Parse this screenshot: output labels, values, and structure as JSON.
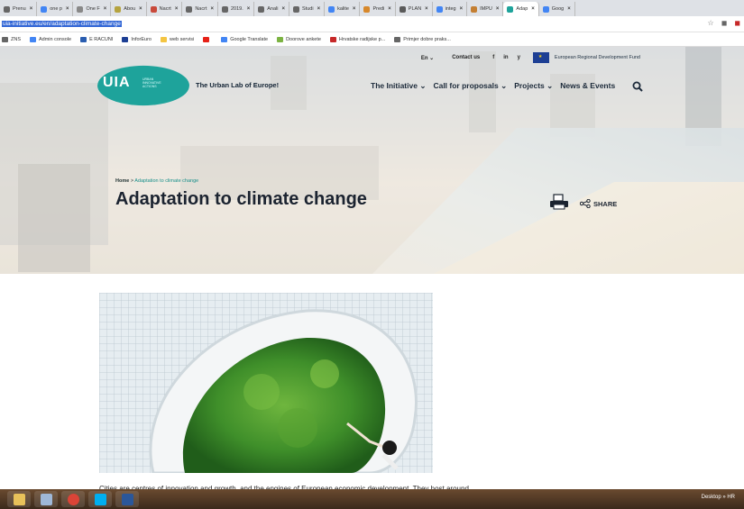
{
  "browser": {
    "tabs": [
      {
        "label": "Prenu",
        "color": "#666"
      },
      {
        "label": "one p",
        "color": "#4285f4"
      },
      {
        "label": "One F",
        "color": "#888"
      },
      {
        "label": "Abou",
        "color": "#b5a33f"
      },
      {
        "label": "Nacrt",
        "color": "#c94a3b"
      },
      {
        "label": "Nacrt",
        "color": "#666"
      },
      {
        "label": "2019.",
        "color": "#666"
      },
      {
        "label": "Anali",
        "color": "#666"
      },
      {
        "label": "Studi",
        "color": "#666"
      },
      {
        "label": "kalite",
        "color": "#4285f4"
      },
      {
        "label": "Predi",
        "color": "#d7882b"
      },
      {
        "label": "PLAN",
        "color": "#5a5a5a"
      },
      {
        "label": "integ",
        "color": "#4285f4"
      },
      {
        "label": "IMPU",
        "color": "#c47f33"
      },
      {
        "label": "Adap",
        "color": "#1ea39b",
        "active": true
      },
      {
        "label": "Goog",
        "color": "#4285f4"
      }
    ],
    "url": "uia-initiative.eu/en/adaptation-climate-change",
    "bookmarks": [
      {
        "label": "ZNS",
        "color": "#666"
      },
      {
        "label": "Admin console",
        "color": "#4285f4"
      },
      {
        "label": "E RACUNI",
        "color": "#2a5db0"
      },
      {
        "label": "InforEuro",
        "color": "#1d3f94"
      },
      {
        "label": "web servisi",
        "color": "#f4c542"
      },
      {
        "label": "",
        "color": "#e62117"
      },
      {
        "label": "Google Translate",
        "color": "#4285f4"
      },
      {
        "label": "Doorove ankete",
        "color": "#7cb342"
      },
      {
        "label": "Hrvatske radijske p...",
        "color": "#c62828"
      },
      {
        "label": "Primjer dobre praks...",
        "color": "#666"
      }
    ]
  },
  "site": {
    "lang": "En",
    "contact": "Contact us",
    "social": [
      "f",
      "in",
      "y"
    ],
    "erdf": "European Regional Development Fund",
    "logo": "UIA",
    "logo_sub": "URBAN INNOVATIVE ACTIONS",
    "tagline": "The Urban Lab of Europe!",
    "nav": [
      "The Initiative",
      "Call for proposals",
      "Projects",
      "News & Events"
    ]
  },
  "page": {
    "breadcrumb_home": "Home",
    "breadcrumb_sep": ">",
    "breadcrumb_current": "Adaptation to climate change",
    "title": "Adaptation to climate change",
    "share": "SHARE",
    "intro": "Cities are centres of innovation and growth, and the engines of European economic development. They host around"
  },
  "taskbar": {
    "desktop": "Desktop",
    "lang": "HR",
    "apps": [
      {
        "name": "explorer",
        "color": "#e8c15a"
      },
      {
        "name": "calculator",
        "color": "#9fb8d8"
      },
      {
        "name": "chrome",
        "color": "#db4437"
      },
      {
        "name": "skype",
        "color": "#00aff0"
      },
      {
        "name": "word",
        "color": "#2b579a"
      }
    ]
  }
}
